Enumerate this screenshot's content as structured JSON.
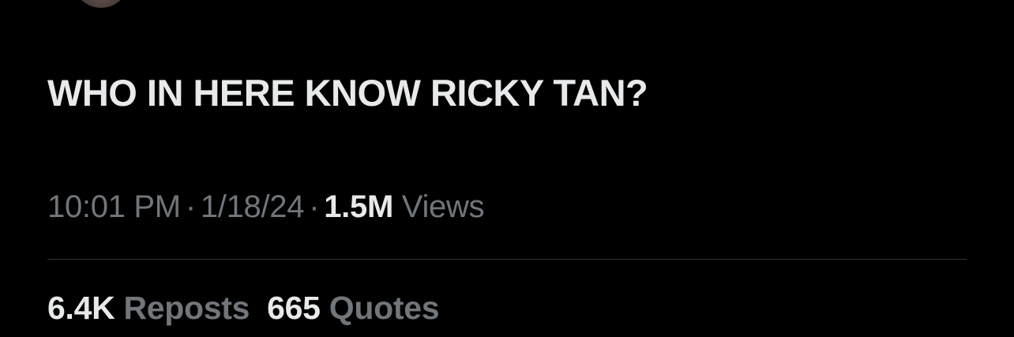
{
  "tweet": {
    "text": "WHO IN HERE KNOW RICKY TAN?"
  },
  "meta": {
    "time": "10:01 PM",
    "separator": "·",
    "date": "1/18/24",
    "views_count": "1.5M",
    "views_label": "Views"
  },
  "stats": [
    {
      "count": "6.4K",
      "label": "Reposts"
    },
    {
      "count": "665",
      "label": "Quotes"
    }
  ],
  "colors": {
    "background": "#000000",
    "primary_text": "#e7e9ea",
    "secondary_text": "#71767b",
    "divider": "#2f3336"
  }
}
